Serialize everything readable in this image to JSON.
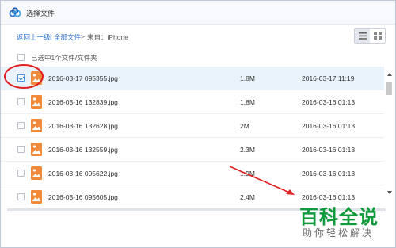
{
  "window": {
    "title": "选择文件",
    "logo_icon": "baidu-netdisk-cloud-icon",
    "accent_color": "#2b73d0"
  },
  "breadcrumb": {
    "back_label": "返回上一级",
    "separator": "|",
    "all_files_label": "全部文件",
    "arrow": ">",
    "current_label": "来自：iPhone"
  },
  "view_toggle": {
    "list_icon": "list-view-icon",
    "grid_icon": "grid-view-icon",
    "active": "list"
  },
  "selection": {
    "summary": "已选中1个文件/文件夹"
  },
  "files": [
    {
      "name": "2016-03-17 095355.jpg",
      "size": "1.8M",
      "date": "2016-03-17 11:19",
      "checked": true
    },
    {
      "name": "2016-03-16 132839.jpg",
      "size": "1.8M",
      "date": "2016-03-16 01:13",
      "checked": false
    },
    {
      "name": "2016-03-16 132628.jpg",
      "size": "2M",
      "date": "2016-03-16 01:13",
      "checked": false
    },
    {
      "name": "2016-03-16 132559.jpg",
      "size": "2.3M",
      "date": "2016-03-16 01:13",
      "checked": false
    },
    {
      "name": "2016-03-16 095622.jpg",
      "size": "1.9M",
      "date": "2016-03-16 01:13",
      "checked": false
    },
    {
      "name": "2016-03-16 095605.jpg",
      "size": "2.4M",
      "date": "2016-03-16 01:13",
      "checked": false
    }
  ],
  "file_icon": "image-file-icon",
  "file_icon_color": "#f08a3a",
  "annotation_color": "#e02020",
  "watermark": {
    "main": "百科全说",
    "sub": "助你轻松解决",
    "color": "#0f9a3c"
  }
}
